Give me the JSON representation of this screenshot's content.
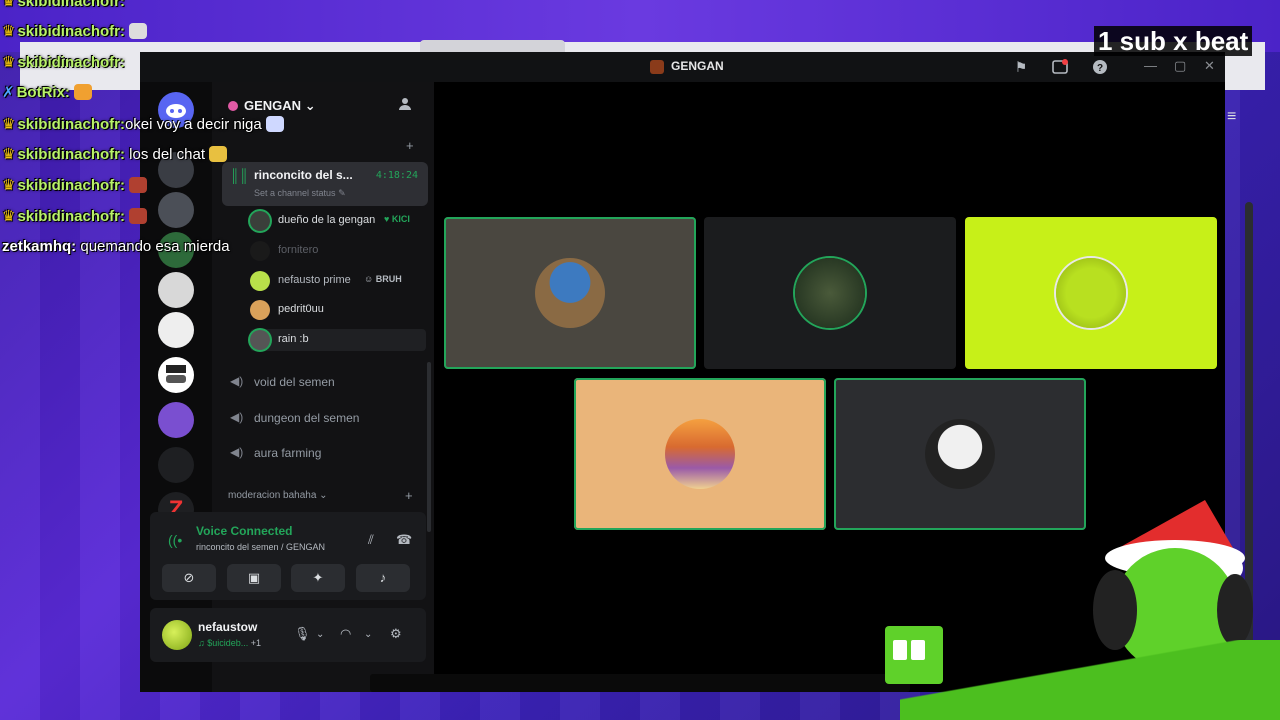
{
  "overlay": {
    "sub_banner": "1 sub x beat"
  },
  "chat": [
    {
      "user": "skibidinachofr:",
      "msg": "",
      "style": "green"
    },
    {
      "user": "skibidinachofr:",
      "msg": "",
      "style": "green"
    },
    {
      "user": "skibidinachofr:",
      "msg": "",
      "style": "green"
    },
    {
      "user": "BotRix:",
      "msg": "",
      "style": "green"
    },
    {
      "user": "skibidinachofr:",
      "msg": "okei voy a decir niga",
      "style": "green"
    },
    {
      "user": "skibidinachofr:",
      "msg": "los del chat",
      "style": "green"
    },
    {
      "user": "skibidinachofr:",
      "msg": "",
      "style": "green"
    },
    {
      "user": "skibidinachofr:",
      "msg": "",
      "style": "green"
    },
    {
      "user": "zetkamhq:",
      "msg": "quemando esa mierda",
      "style": "plain"
    }
  ],
  "window": {
    "title": "GENGAN"
  },
  "sidebar": {
    "guild_name": "GENGAN",
    "active_channel": {
      "name": "rinconcito del s...",
      "time": "4:18:24",
      "status_placeholder": "Set a channel status"
    },
    "members": [
      {
        "name": "dueño de la gengan",
        "tag": "KICI"
      },
      {
        "name": "fornitero",
        "tag": ""
      },
      {
        "name": "nefausto prime",
        "tag": "BRUH"
      },
      {
        "name": "pedrit0uu",
        "tag": ""
      },
      {
        "name": "rain :b",
        "tag": ""
      }
    ],
    "channels": [
      {
        "name": "void del semen"
      },
      {
        "name": "dungeon del semen"
      },
      {
        "name": "aura farming"
      }
    ],
    "category": "moderacion bahaha"
  },
  "voice_panel": {
    "title": "Voice Connected",
    "subtitle": "rinconcito del semen / GENGAN"
  },
  "user_panel": {
    "name": "nefaustow",
    "status": "♫ $uicideb...",
    "extra": "+1"
  },
  "colors": {
    "speaking": "#23a55a",
    "tile_1": "#4a4740",
    "tile_2": "#1b1c1e",
    "tile_3": "#c7f018",
    "tile_4": "#eab57a",
    "tile_5": "#2c2d30"
  }
}
